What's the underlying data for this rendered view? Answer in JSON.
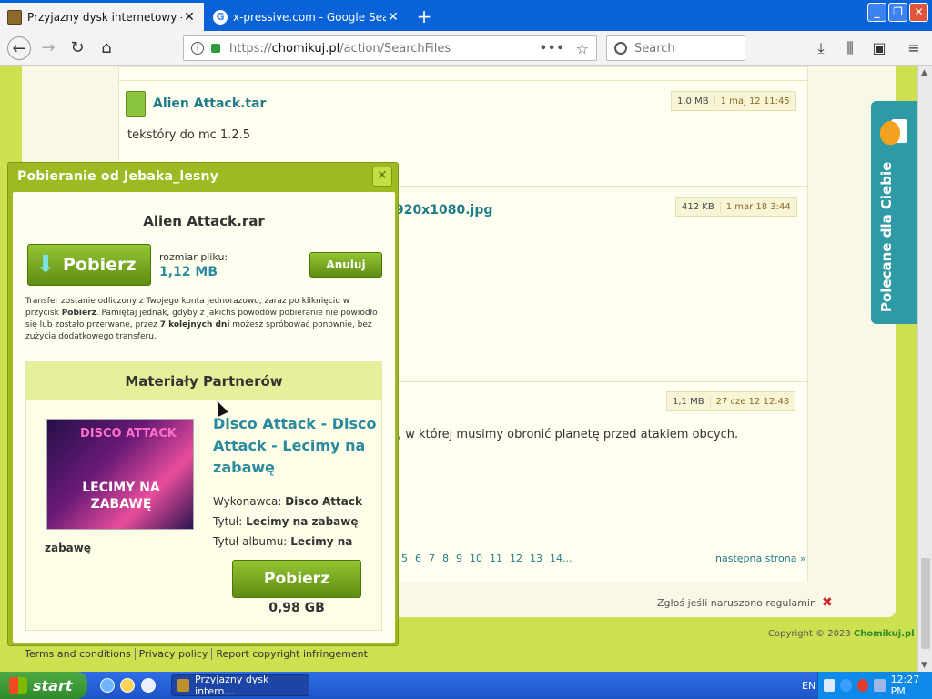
{
  "browser": {
    "tabs": [
      {
        "title": "Przyjazny dysk internetowy - Chomikuj",
        "favicon": "chomikuj-icon",
        "active": true
      },
      {
        "title": "x-pressive.com - Google Search",
        "favicon": "google-icon",
        "active": false
      }
    ],
    "url": "https://chomikuj.pl/action/SearchFiles",
    "url_prefix": "https://",
    "url_domain": "chomikuj.pl",
    "url_path": "/action/SearchFiles",
    "search_placeholder": "Search"
  },
  "page": {
    "file1": {
      "name": "Alien Attack.tar",
      "size": "1,0 MB",
      "date": "1 maj 12 11:45",
      "description": "tekstóry do mc 1.2.5"
    },
    "file2": {
      "name_fragment": "920x1080.jpg",
      "size": "412 KB",
      "date": "1 mar 18 3:44"
    },
    "file3": {
      "size": "1,1 MB",
      "date": "27 cze 12 12:48",
      "description_fragment": ", w której musimy obronić planetę przed atakiem obcych."
    },
    "pagination": [
      "5",
      "6",
      "7",
      "8",
      "9",
      "10",
      "11",
      "12",
      "13",
      "14..."
    ],
    "next_page": "następna strona »",
    "report": "Zgłoś jeśli naruszono regulamin",
    "copyright": "Copyright © 2023",
    "copyright_brand": "Chomikuj.pl",
    "footer_links": [
      "Terms and conditions",
      "Privacy policy",
      "Report copyright infringement"
    ],
    "side_tab": "Polecane dla Ciebie"
  },
  "modal": {
    "title": "Pobieranie od Jebaka_lesny",
    "filename": "Alien Attack.rar",
    "download_label": "Pobierz",
    "size_label": "rozmiar pliku:",
    "size_value": "1,12 MB",
    "cancel_label": "Anuluj",
    "notice_part1": "Transfer zostanie odliczony z Twojego konta jednorazowo, zaraz po kliknięciu w przycisk ",
    "notice_bold1": "Pobierz",
    "notice_part2": ". Pamiętaj jednak, gdyby z jakichś powodów pobieranie nie powiodło się lub zostało przerwane, przez ",
    "notice_bold2": "7 kolejnych dni",
    "notice_part3": " możesz spróbować ponownie, bez zużycia dodatkowego transferu.",
    "partners": {
      "heading": "Materiały Partnerów",
      "album_line1": "DISCO ATTACK",
      "album_line2": "LECIMY NA ZABAWĘ",
      "song_title": "Disco Attack - Disco Attack - Lecimy na zabawę",
      "artist_label": "Wykonawca:",
      "artist": "Disco Attack",
      "title_label": "Tytuł:",
      "title": "Lecimy na zabawę",
      "album_label": "Tytuł albumu:",
      "album": "Lecimy na",
      "album_tail": "zabawę",
      "download_label": "Pobierz",
      "download_size": "0,98 GB"
    }
  },
  "taskbar": {
    "start_label": "start",
    "task_item": "Przyjazny dysk intern...",
    "language": "EN",
    "clock": "12:27 PM"
  }
}
